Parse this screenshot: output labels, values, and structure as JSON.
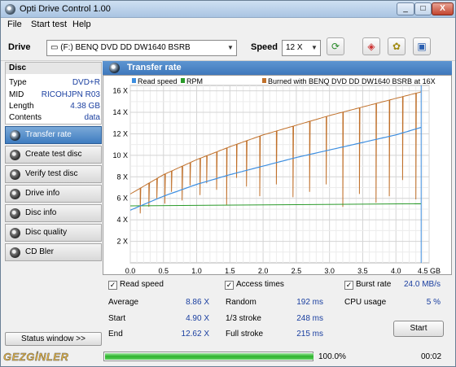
{
  "window": {
    "title": "Opti Drive Control 1.00",
    "minimize": "_",
    "maximize": "□",
    "close": "X"
  },
  "menu": [
    "File",
    "Start test",
    "Help"
  ],
  "toolbar": {
    "drive_label": "Drive",
    "drive_value": "(F:)   BENQ DVD DD DW1640 BSRB",
    "speed_label": "Speed",
    "speed_value": "12 X",
    "refresh_icon": "refresh-icon",
    "erase_icon": "eraser-icon",
    "options_icon": "options-icon",
    "save_icon": "save-icon"
  },
  "disc": {
    "title": "Disc",
    "rows": [
      {
        "key": "Type",
        "value": "DVD+R"
      },
      {
        "key": "MID",
        "value": "RICOHJPN R03"
      },
      {
        "key": "Length",
        "value": "4.38 GB"
      },
      {
        "key": "Contents",
        "value": "data"
      }
    ]
  },
  "nav": [
    {
      "label": "Transfer rate",
      "active": true
    },
    {
      "label": "Create test disc",
      "active": false
    },
    {
      "label": "Verify test disc",
      "active": false
    },
    {
      "label": "Drive info",
      "active": false
    },
    {
      "label": "Disc info",
      "active": false
    },
    {
      "label": "Disc quality",
      "active": false
    },
    {
      "label": "CD Bler",
      "active": false
    }
  ],
  "status_window": "Status window >>",
  "watermark": "GEZGİNLER",
  "chart_header": "Transfer rate",
  "chart_data": {
    "type": "line",
    "legend": {
      "read_speed": "Read speed",
      "rpm": "RPM",
      "burned": "Burned with BENQ DVD DD DW1640 BSRB at 16X"
    },
    "x_ticks": [
      "0.0",
      "0.5",
      "1.0",
      "1.5",
      "2.0",
      "2.5",
      "3.0",
      "3.5",
      "4.0",
      "4.5 GB"
    ],
    "y_ticks": [
      "2 X",
      "4 X",
      "6 X",
      "8 X",
      "10 X",
      "12 X",
      "14 X",
      "16 X"
    ],
    "xlim": [
      0,
      4.5
    ],
    "ylim": [
      0,
      16.5
    ],
    "colors": {
      "read_speed": "#3d8ee0",
      "rpm": "#2a9a2a",
      "burned": "#c0702a"
    },
    "series": [
      {
        "name": "Read speed",
        "x": [
          0.0,
          0.5,
          1.0,
          1.5,
          2.0,
          2.5,
          3.0,
          3.5,
          4.0,
          4.38
        ],
        "y": [
          4.9,
          6.2,
          7.3,
          8.2,
          9.0,
          9.8,
          10.5,
          11.2,
          11.9,
          12.6
        ]
      },
      {
        "name": "RPM",
        "x": [
          0.0,
          4.38
        ],
        "y": [
          5.3,
          5.5
        ]
      },
      {
        "name": "Burned with BENQ DVD DD DW1640 BSRB at 16X",
        "x": [
          0.0,
          0.5,
          1.0,
          1.5,
          2.0,
          2.5,
          3.0,
          3.5,
          4.0,
          4.38
        ],
        "y": [
          6.4,
          8.2,
          9.6,
          10.8,
          11.9,
          12.8,
          13.7,
          14.5,
          15.3,
          15.9
        ]
      },
      {
        "name": "Burn dips",
        "x": [
          0.15,
          0.28,
          0.4,
          0.52,
          0.62,
          0.78,
          0.9,
          1.05,
          1.15,
          1.3,
          1.45,
          1.6,
          1.75,
          1.95,
          2.2,
          2.45,
          2.7,
          2.95,
          3.2,
          3.45,
          3.7,
          3.9,
          4.1,
          4.3
        ],
        "y": [
          4.6,
          5.2,
          6.0,
          5.5,
          6.6,
          5.8,
          7.2,
          6.3,
          7.4,
          6.8,
          5.4,
          7.9,
          7.1,
          6.2,
          7.3,
          6.1,
          6.6,
          7.3,
          5.2,
          6.4,
          5.6,
          6.2,
          7.7,
          5.9
        ]
      }
    ],
    "grid": true
  },
  "options": {
    "read_speed": "Read speed",
    "access_times": "Access times",
    "burst_rate": "Burst rate"
  },
  "stats": {
    "average_label": "Average",
    "average": "8.86 X",
    "start_label": "Start",
    "start": "4.90 X",
    "end_label": "End",
    "end": "12.62 X",
    "random_label": "Random",
    "random": "192 ms",
    "third_label": "1/3 stroke",
    "third": "248 ms",
    "full_label": "Full stroke",
    "full": "215 ms",
    "burst_value": "24.0 MB/s",
    "cpu_label": "CPU usage",
    "cpu": "5 %"
  },
  "start_button": "Start",
  "progress": {
    "value": 1.0,
    "percent_text": "100.0%"
  },
  "elapsed": "00:02"
}
